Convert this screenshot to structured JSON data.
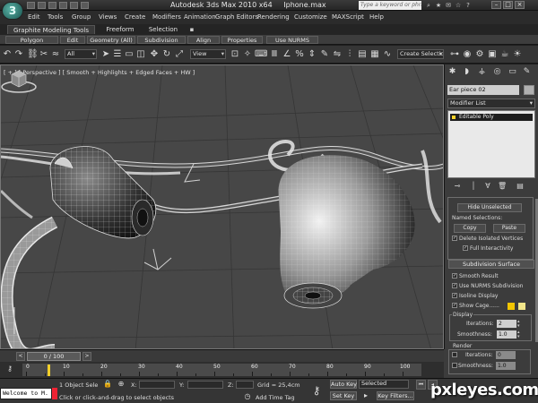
{
  "titlebar": {
    "app_title": "Autodesk 3ds Max  2010 x64",
    "file_name": "Iphone.max",
    "search_placeholder": "Type a keyword or phrase"
  },
  "app_logo": {
    "label": "3"
  },
  "menubar": {
    "items": [
      "Edit",
      "Tools",
      "Group",
      "Views",
      "Create",
      "Modifiers",
      "Animation",
      "Graph Editors",
      "Rendering",
      "Customize",
      "MAXScript",
      "Help"
    ]
  },
  "ribbon": {
    "tabs": [
      "Graphite Modeling Tools",
      "Freeform",
      "Selection"
    ],
    "panels": [
      "Polygon Modeling",
      "Edit",
      "Geometry (All)",
      "Subdivision",
      "Align",
      "Properties",
      "Use NURMS"
    ]
  },
  "toolbar": {
    "filter_all": "All",
    "ref_coord": "View",
    "named_selection": "Create Selection Se"
  },
  "viewport": {
    "label": "[ + ] [ Perspective ] [ Smooth + Highlights + Edged Faces + HW ]"
  },
  "command_panel": {
    "object_name": "Ear piece 02",
    "modifier_list": "Modifier List",
    "stack_item": "Editable Poly",
    "hide_unselected": "Hide Unselected",
    "named_selections_label": "Named Selections:",
    "copy_label": "Copy",
    "paste_label": "Paste",
    "delete_isolated": "Delete Isolated Vertices",
    "full_interactivity": "Full Interactivity",
    "subdivision_surface": "Subdivision Surface",
    "smooth_result": "Smooth Result",
    "use_nurms": "Use NURMS Subdivision",
    "isoline_display": "Isoline Display",
    "show_cage": "Show Cage......",
    "display_label": "Display",
    "iterations_label": "Iterations:",
    "smoothness_label": "Smoothness:",
    "display_iterations": "2",
    "display_smoothness": "1.0",
    "render_label": "Render",
    "render_iterations": "0",
    "render_smoothness": "1.0",
    "cage_colors": [
      "#f2c500",
      "#f2e68a"
    ]
  },
  "timeline": {
    "slider_label": "0 / 100",
    "prev_label": "<",
    "next_label": ">"
  },
  "trackbar": {
    "ticks": [
      "0",
      "10",
      "20",
      "30",
      "40",
      "50",
      "60",
      "70",
      "80",
      "90",
      "100"
    ]
  },
  "status": {
    "maxscript_text": "Welcome to M.",
    "selection_count": "1 Object Sele",
    "prompt": "Click or click-and-drag to select objects",
    "x_label": "X:",
    "y_label": "Y:",
    "z_label": "Z:",
    "grid": "Grid = 25,4cm",
    "add_time_tag": "Add Time Tag",
    "auto_key": "Auto Key",
    "set_key": "Set Key",
    "selected": "Selected",
    "key_filters": "Key Filters..."
  },
  "watermark": "pxleyes.com"
}
